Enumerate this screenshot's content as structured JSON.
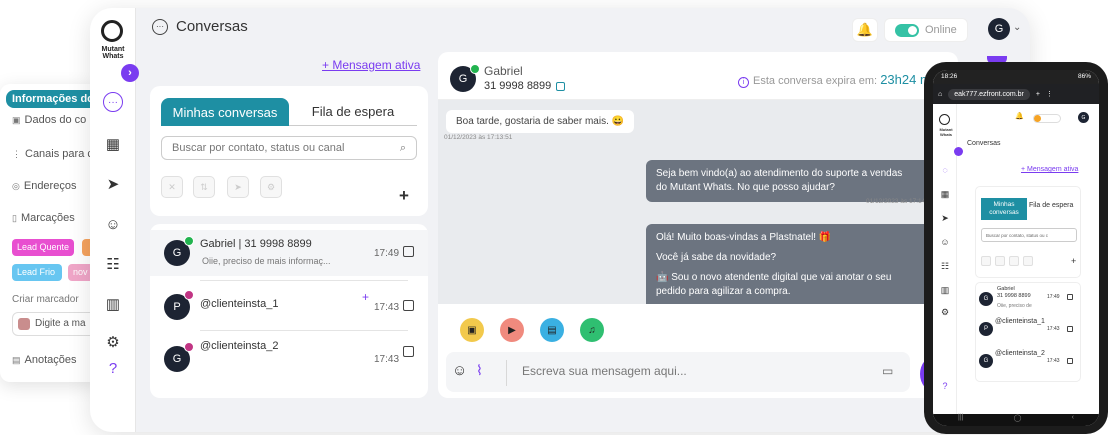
{
  "info_panel": {
    "header": "Informações do",
    "items": [
      {
        "icon": "contact-card-icon",
        "label": "Dados do co"
      },
      {
        "icon": "channels-icon",
        "label": "Canais para c"
      },
      {
        "icon": "location-pin-icon",
        "label": "Endereços"
      },
      {
        "icon": "bookmark-icon",
        "label": "Marcações"
      }
    ],
    "tags": [
      {
        "label": "Lead Quente",
        "color": "#e84fd0"
      },
      {
        "label": "",
        "color": "#f6a35e"
      },
      {
        "label": "Lead Frio",
        "color": "#67c6f1"
      },
      {
        "label": "nov",
        "color": "#f0a6c8"
      }
    ],
    "create_tag_label": "Criar marcador",
    "create_tag_input": "Digite a ma",
    "notes_label": "Anotações"
  },
  "app": {
    "logo_text": "Mutant Whats",
    "page_title": "Conversas",
    "status_label": "Online",
    "user_initial": "G",
    "new_message_label": "+ Mensagem ativa",
    "nav_icons": [
      "chat-icon",
      "apps-grid-icon",
      "send-icon",
      "bot-icon",
      "contacts-icon",
      "reports-icon",
      "settings-icon",
      "help-icon"
    ]
  },
  "list": {
    "tabs": [
      "Minhas conversas",
      "Fila de espera"
    ],
    "search_placeholder": "Buscar por contato, status ou canal",
    "conversations": [
      {
        "initial": "G",
        "channel": "whatsapp",
        "name": "Gabriel | 31 9998 8899",
        "preview": "Oiie, preciso de mais informaç...",
        "time": "17:49"
      },
      {
        "initial": "P",
        "channel": "instagram",
        "name": "@clienteinsta_1",
        "preview": "",
        "time": "17:43"
      },
      {
        "initial": "G",
        "channel": "instagram",
        "name": "@clienteinsta_2",
        "preview": "",
        "time": "17:43"
      }
    ]
  },
  "chat": {
    "contact_initial": "G",
    "contact_name": "Gabriel",
    "contact_phone": "31 9998 8899",
    "expiry_label": "Esta conversa expira em:",
    "expiry_value": "23h24 m",
    "messages": [
      {
        "dir": "in",
        "text": "Boa tarde, gostaria de saber mais. 😀",
        "ts": "01/12/2023 às 17:13:51"
      },
      {
        "dir": "out",
        "lines": [
          "Seja bem vindo(a) ao atendimento do suporte a vendas",
          "do Mutant Whats. No que posso ajudar?"
        ],
        "ts": "01/12/2023 às 17:14"
      },
      {
        "dir": "out",
        "lines": [
          "Olá! Muito boas-vindas a Plastnatel! 🎁",
          "",
          "Você já sabe da novidade?",
          "",
          "🤖 Sou o novo atendente digital que vai anotar o seu",
          "pedido para agilizar a compra."
        ],
        "ts": ""
      }
    ],
    "attach_colors": [
      "#f2c94c",
      "#f08a7e",
      "#3ab0e2",
      "#2fbf71"
    ],
    "composer_placeholder": "Escreva sua mensagem aqui..."
  },
  "phone": {
    "time": "18:26",
    "status_icons": "86%",
    "url": "eak777.ezfront.com.br",
    "tab_count": "",
    "page_title": "Conversas",
    "new_message_label": "+ Mensagem ativa",
    "tabs": [
      "Minhas conversas",
      "Fila de espera"
    ],
    "search_placeholder": "Buscar por contato, status ou c",
    "conversations": [
      {
        "initial": "G",
        "name": "Gabriel",
        "sub": "31 9998 8899",
        "preview": "Oiie, preciso de",
        "time": "17:49"
      },
      {
        "initial": "P",
        "name": "@clienteinsta_1",
        "sub": "",
        "preview": "",
        "time": "17:43"
      },
      {
        "initial": "G",
        "name": "@clienteinsta_2",
        "sub": "",
        "preview": "",
        "time": "17:43"
      }
    ]
  }
}
